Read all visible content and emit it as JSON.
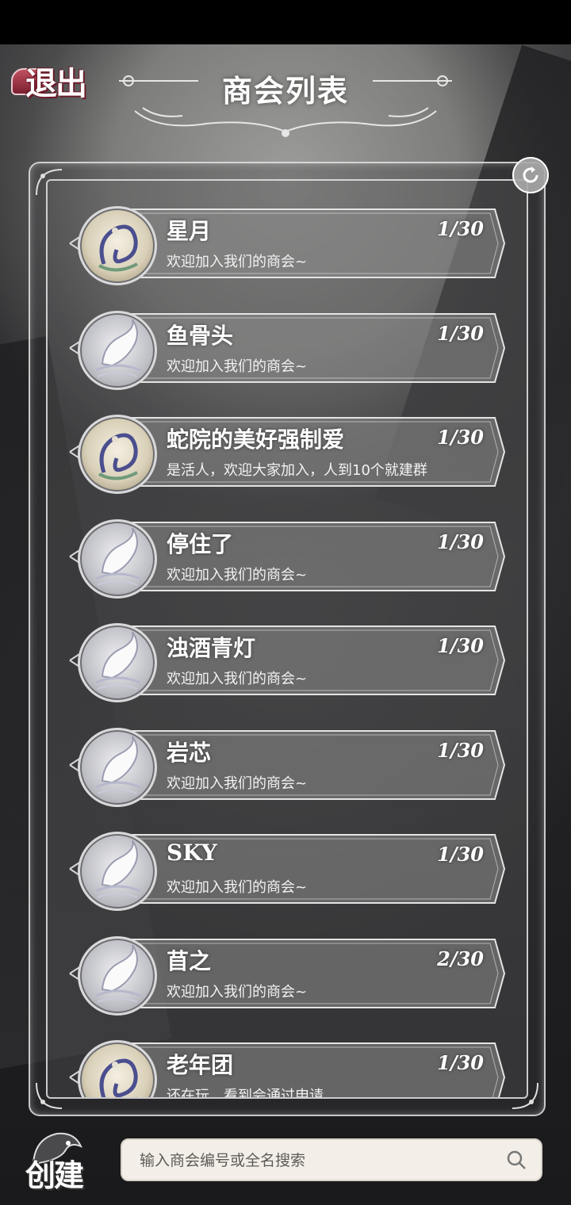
{
  "header": {
    "back_label": "退出",
    "title": "商会列表"
  },
  "guilds": [
    {
      "name": "星月",
      "count": "1/30",
      "desc": "欢迎加入我们的商会~",
      "avatar": "snake"
    },
    {
      "name": "鱼骨头",
      "count": "1/30",
      "desc": "欢迎加入我们的商会~",
      "avatar": "crane"
    },
    {
      "name": "蛇院的美好强制爱",
      "count": "1/30",
      "desc": "是活人，欢迎大家加入，人到10个就建群",
      "avatar": "snake"
    },
    {
      "name": "停住了",
      "count": "1/30",
      "desc": "欢迎加入我们的商会~",
      "avatar": "crane"
    },
    {
      "name": "浊酒青灯",
      "count": "1/30",
      "desc": "欢迎加入我们的商会~",
      "avatar": "crane"
    },
    {
      "name": "岩芯",
      "count": "1/30",
      "desc": "欢迎加入我们的商会~",
      "avatar": "crane"
    },
    {
      "name": "SKY",
      "count": "1/30",
      "desc": "欢迎加入我们的商会~",
      "avatar": "crane"
    },
    {
      "name": "苜之",
      "count": "2/30",
      "desc": "欢迎加入我们的商会~",
      "avatar": "crane"
    },
    {
      "name": "老年团",
      "count": "1/30",
      "desc": "还在玩，看到会通过申请",
      "avatar": "snake"
    }
  ],
  "footer": {
    "create_label": "创建",
    "search_placeholder": "输入商会编号或全名搜索"
  },
  "icons": {
    "refresh": "refresh-icon",
    "search": "search-icon",
    "crane_avatar": "crane-emblem-icon",
    "snake_avatar": "snake-emblem-icon"
  }
}
